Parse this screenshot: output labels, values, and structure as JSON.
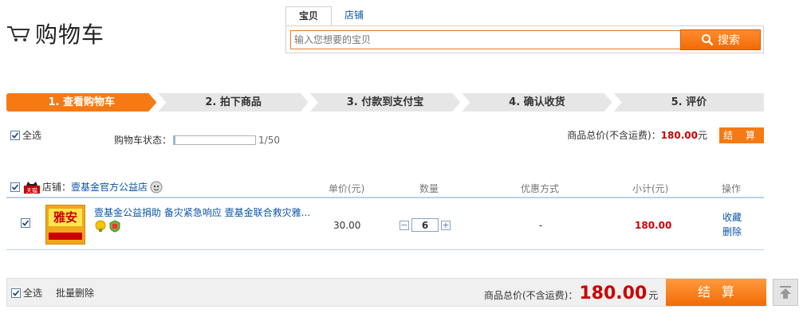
{
  "header": {
    "title": "购物车",
    "cart_icon": "cart-icon"
  },
  "search": {
    "tabs": [
      "宝贝",
      "店铺"
    ],
    "placeholder": "输入您想要的宝贝",
    "button_label": "搜索"
  },
  "steps": [
    {
      "label": "1. 查看购物车",
      "active": true
    },
    {
      "label": "2. 拍下商品",
      "active": false
    },
    {
      "label": "3. 付款到支付宝",
      "active": false
    },
    {
      "label": "4. 确认收货",
      "active": false
    },
    {
      "label": "5. 评价",
      "active": false
    }
  ],
  "toolbar": {
    "select_all": "全选",
    "status_label": "购物车状态：",
    "status_count": "1/50",
    "status_fraction": 0.02,
    "total_label": "商品总价(不含运费)：",
    "total_value": "180.00",
    "currency": "元",
    "checkout_label": "结 算"
  },
  "table": {
    "shop_label": "店铺：",
    "shop_name": "壹基金官方公益店",
    "tmall_badge": "天猫",
    "columns": {
      "unit_price": "单价(元)",
      "quantity": "数量",
      "discount": "优惠方式",
      "subtotal": "小计(元)",
      "actions": "操作"
    },
    "items": [
      {
        "title": "壹基金公益捐助 备灾紧急响应 壹基金联合救灾雅...",
        "thumb_text": "雅安",
        "unit_price": "30.00",
        "quantity": "6",
        "discount": "-",
        "subtotal": "180.00",
        "action_favorite": "收藏",
        "action_delete": "删除",
        "badges": [
          "gold-badge-icon",
          "genuine-badge-icon"
        ]
      }
    ]
  },
  "footer": {
    "select_all": "全选",
    "batch_delete": "批量删除",
    "total_label": "商品总价(不含运费)：",
    "total_value": "180.00",
    "currency": "元",
    "checkout_label": "结算"
  },
  "colors": {
    "accent": "#f57a14",
    "price": "#cc0000",
    "link": "#0a55a4"
  }
}
